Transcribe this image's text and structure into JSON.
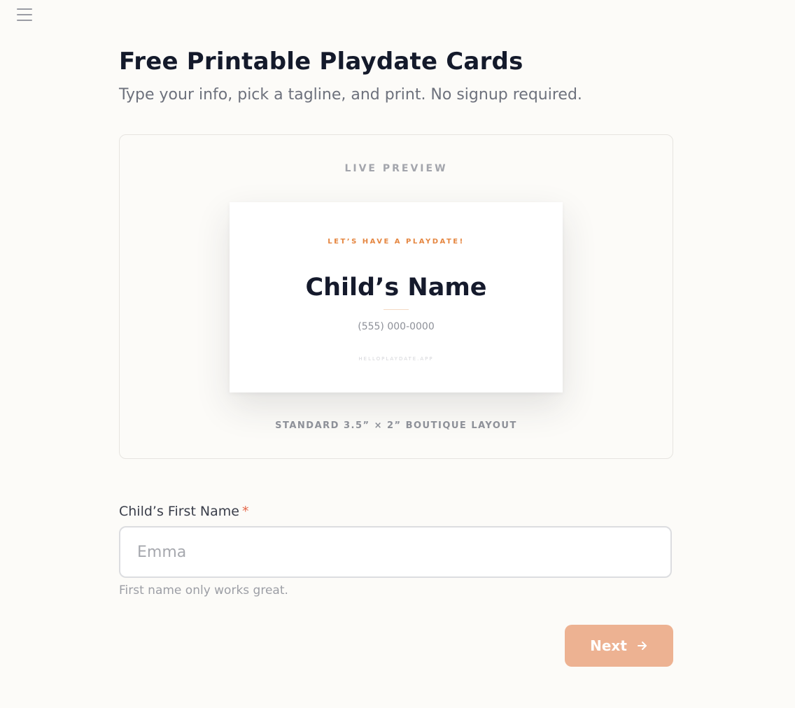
{
  "header": {
    "menu_icon": "hamburger-menu-icon"
  },
  "page": {
    "title": "Free Printable Playdate Cards",
    "subtitle": "Type your info, pick a tagline, and print. No signup required."
  },
  "preview": {
    "label": "LIVE PREVIEW",
    "card": {
      "tagline": "LET’S HAVE A PLAYDATE!",
      "name": "Child’s Name",
      "phone": "(555) 000-0000",
      "url": "HELLOPLAYDATE.APP"
    },
    "caption": "STANDARD 3.5” × 2” BOUTIQUE LAYOUT"
  },
  "form": {
    "name_field": {
      "label": "Child’s First Name",
      "required_mark": "*",
      "placeholder": "Emma",
      "value": "",
      "hint": "First name only works great."
    },
    "next_button": {
      "label": "Next",
      "icon": "arrow-right-icon"
    }
  },
  "colors": {
    "background": "#fcfbf8",
    "accent": "#e58640",
    "button": "#edb292",
    "required": "#e5674a"
  }
}
